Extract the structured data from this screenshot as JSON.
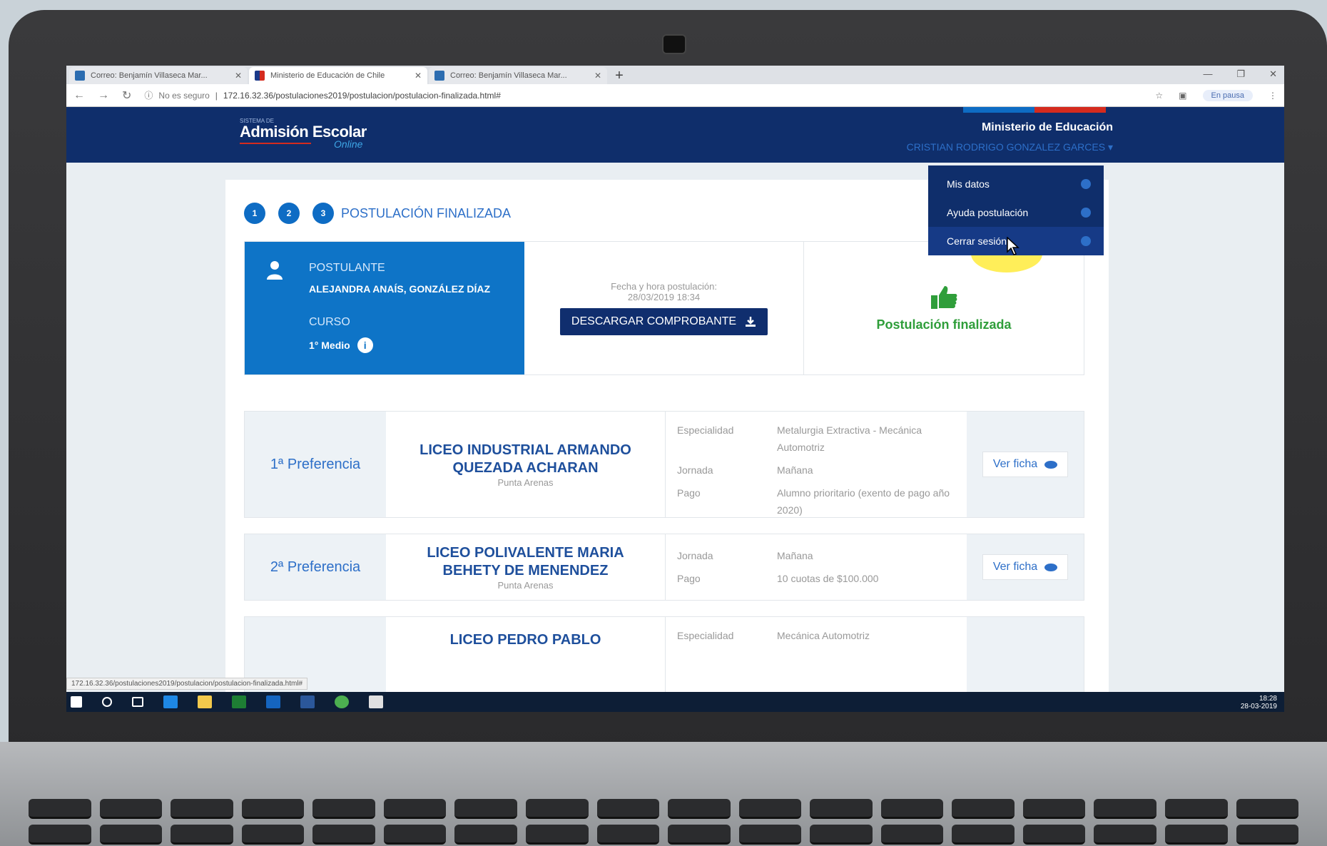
{
  "browser": {
    "tabs": [
      {
        "title": "Correo: Benjamín Villaseca Mar...",
        "active": false
      },
      {
        "title": "Ministerio de Educación de Chile",
        "active": true
      },
      {
        "title": "Correo: Benjamín Villaseca Mar...",
        "active": false
      }
    ],
    "new_tab": "+",
    "security": "No es seguro",
    "url": "172.16.32.36/postulaciones2019/postulacion/postulacion-finalizada.html#",
    "profile": "En pausa",
    "status_url": "172.16.32.36/postulaciones2019/postulacion/postulacion-finalizada.html#"
  },
  "header": {
    "logo_small": "SISTEMA DE",
    "logo": "Admisión Escolar",
    "logo_sub": "Online",
    "ministry": "Ministerio de Educación",
    "user": "CRISTIAN RODRIGO GONZALEZ GARCES ▾",
    "stripe_colors": [
      "#0e6cc4",
      "#d52b1e"
    ]
  },
  "user_menu": {
    "items": [
      {
        "label": "Mis datos",
        "icon": "user-icon"
      },
      {
        "label": "Ayuda postulación",
        "icon": "help-icon"
      },
      {
        "label": "Cerrar sesión",
        "icon": "logout-icon"
      }
    ]
  },
  "steps": {
    "numbers": [
      "1",
      "2",
      "3"
    ],
    "label": "POSTULACIÓN FINALIZADA"
  },
  "applicant": {
    "label": "POSTULANTE",
    "name": "ALEJANDRA ANAÍS, GONZÁLEZ DÍAZ",
    "course_label": "CURSO",
    "course": "1° Medio",
    "info": "i"
  },
  "submission": {
    "date_label": "Fecha y hora postulación:",
    "date": "28/03/2019 18:34",
    "download_button": "DESCARGAR COMPROBANTE"
  },
  "status": {
    "text": "Postulación finalizada",
    "color": "#2f9e3a"
  },
  "preferences": [
    {
      "label": "1ª Preferencia",
      "school": "LICEO INDUSTRIAL ARMANDO QUEZADA ACHARAN",
      "city": "Punta Arenas",
      "details": [
        {
          "key": "Especialidad",
          "value": "Metalurgia Extractiva - Mecánica Automotriz"
        },
        {
          "key": "Jornada",
          "value": "Mañana"
        },
        {
          "key": "Pago",
          "value": "Alumno prioritario (exento de pago año 2020)"
        }
      ],
      "button": "Ver ficha"
    },
    {
      "label": "2ª Preferencia",
      "school": "LICEO POLIVALENTE MARIA BEHETY DE MENENDEZ",
      "city": "Punta Arenas",
      "details": [
        {
          "key": "Jornada",
          "value": "Mañana"
        },
        {
          "key": "Pago",
          "value": "10 cuotas de $100.000"
        }
      ],
      "button": "Ver ficha"
    },
    {
      "label": "",
      "school": "LICEO PEDRO PABLO",
      "city": "",
      "details": [
        {
          "key": "Especialidad",
          "value": "Mecánica Automotriz"
        }
      ],
      "button": ""
    }
  ],
  "taskbar": {
    "clock_time": "18:28",
    "clock_date": "28-03-2019"
  }
}
